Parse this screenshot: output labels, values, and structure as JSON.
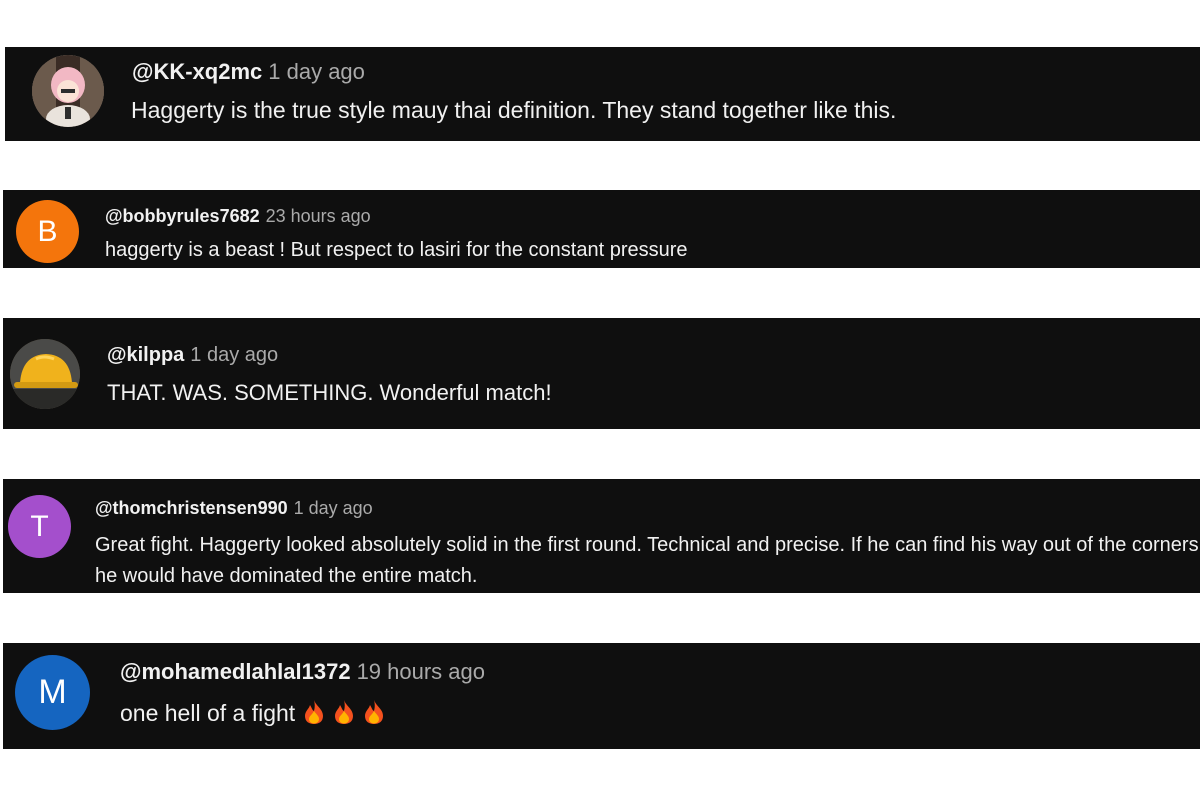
{
  "comments": [
    {
      "handle": "@KK-xq2mc",
      "time": "1 day ago",
      "text": "Haggerty is the true style mauy thai definition. They stand together like this.",
      "avatar": {
        "type": "image",
        "icon": "anime-character-avatar"
      }
    },
    {
      "handle": "@bobbyrules7682",
      "time": "23 hours ago",
      "text": "haggerty is a beast ! But respect to lasiri for the constant pressure",
      "avatar": {
        "type": "letter",
        "letter": "B",
        "color": "#f4750c"
      }
    },
    {
      "handle": "@kilppa",
      "time": "1 day ago",
      "text": "THAT. WAS. SOMETHING. Wonderful match!",
      "avatar": {
        "type": "image",
        "icon": "hardhat-avatar"
      }
    },
    {
      "handle": "@thomchristensen990",
      "time": "1 day ago",
      "text": "Great fight. Haggerty looked absolutely solid in the first round. Technical and precise. If he can find his way out of the corners he would have dominated the entire match.",
      "avatar": {
        "type": "letter",
        "letter": "T",
        "color": "#a44fcc"
      }
    },
    {
      "handle": "@mohamedlahlal1372",
      "time": "19 hours ago",
      "text": "one hell of a fight",
      "emoji": [
        "fire-icon",
        "fire-icon",
        "fire-icon"
      ],
      "avatar": {
        "type": "letter",
        "letter": "M",
        "color": "#1565c0"
      }
    }
  ],
  "colors": {
    "card_background": "#0f0f0f",
    "handle_text": "#f1f1f1",
    "timestamp_text": "#aaaaaa",
    "page_background": "#ffffff"
  }
}
